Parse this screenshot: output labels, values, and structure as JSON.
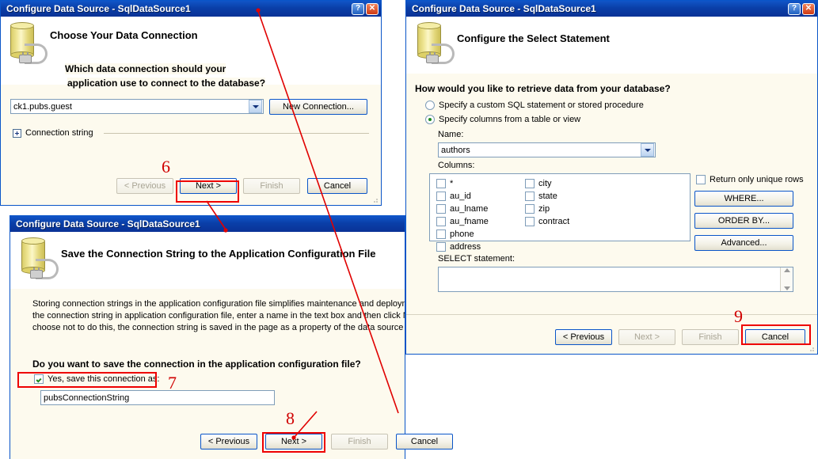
{
  "dialog1": {
    "title": "Configure Data Source - SqlDataSource1",
    "heading": "Choose Your Data Connection",
    "prompt_line1": "Which data connection should your",
    "prompt_line2": "application use to connect to the database?",
    "connection_value": "ck1.pubs.guest",
    "new_connection_label": "New Connection...",
    "connection_string_label": "Connection string",
    "buttons": {
      "previous": "< Previous",
      "next": "Next >",
      "finish": "Finish",
      "cancel": "Cancel"
    },
    "annotation": "6"
  },
  "dialog2": {
    "title": "Configure Data Source - SqlDataSource1",
    "heading": "Configure the Select Statement",
    "prompt": "How would you like to retrieve data from your database?",
    "radio_custom": "Specify a custom SQL statement or stored procedure",
    "radio_columns": "Specify columns from a table or view",
    "name_label": "Name:",
    "name_value": "authors",
    "columns_label": "Columns:",
    "columns_col1": [
      "*",
      "au_id",
      "au_lname",
      "au_fname",
      "phone",
      "address"
    ],
    "columns_col2": [
      "city",
      "state",
      "zip",
      "contract"
    ],
    "unique_rows_label": "Return only unique rows",
    "where_label": "WHERE...",
    "orderby_label": "ORDER BY...",
    "advanced_label": "Advanced...",
    "select_statement_label": "SELECT statement:",
    "select_statement_value": "",
    "buttons": {
      "previous": "< Previous",
      "next": "Next >",
      "finish": "Finish",
      "cancel": "Cancel"
    },
    "annotation": "9"
  },
  "dialog3": {
    "title": "Configure Data Source - SqlDataSource1",
    "heading": "Save the Connection String to the Application Configuration File",
    "paragraph_line1": "Storing connection strings in the application configuration file simplifies maintenance and deployment",
    "paragraph_line2": "the connection string in application configuration file, enter a name in the text box and then click Nex",
    "paragraph_line3": "choose not to do this, the connection string is saved in the page as a property of the data source co",
    "question": "Do you want to save the connection in the application configuration file?",
    "save_checkbox_label": "Yes, save this connection as:",
    "save_checkbox_checked": true,
    "connection_name_value": "pubsConnectionString",
    "buttons": {
      "previous": "< Previous",
      "next": "Next >",
      "finish": "Finish",
      "cancel": "Cancel"
    },
    "annotations": {
      "checkbox": "7",
      "next": "8"
    }
  },
  "titlebar_buttons": {
    "help": "?",
    "close": "✕"
  },
  "colors": {
    "annotation": "#d00000",
    "highlight": "#ee0000",
    "title_blue": "#0A3FA8",
    "body_cream": "#FDFAEE"
  }
}
